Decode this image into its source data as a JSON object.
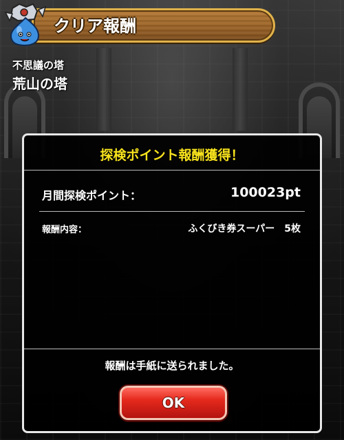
{
  "header": {
    "title": "クリア報酬",
    "icon": "slime-knight-monster-icon"
  },
  "location": {
    "tower": "不思議の塔",
    "floor_name": "荒山の塔"
  },
  "dialog": {
    "title": "探検ポイント報酬獲得！",
    "points_label": "月間探検ポイント：",
    "points_value": "100023pt",
    "reward_label": "報酬内容：",
    "reward_value": "ふくびき券スーパー　5枚",
    "notice": "報酬は手紙に送られました。",
    "ok_label": "OK"
  },
  "colors": {
    "title_yellow": "#f7e21c",
    "button_red": "#e5291d",
    "banner_wood": "#9b6428",
    "banner_border": "#e0b24a"
  }
}
